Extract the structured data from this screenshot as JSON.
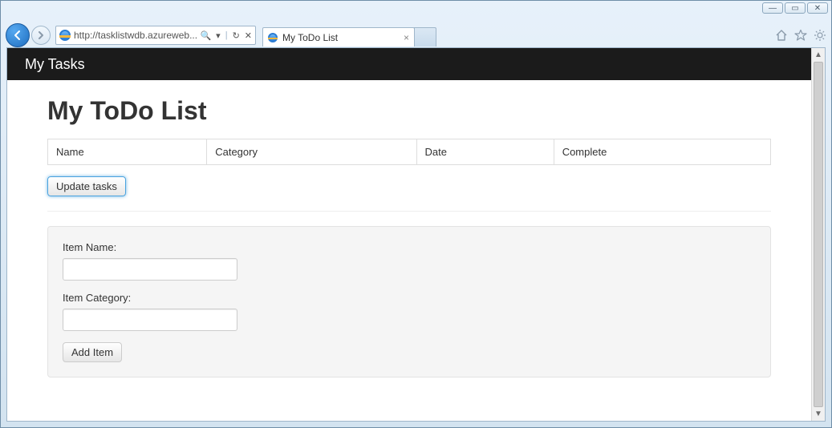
{
  "window": {
    "minimize_glyph": "—",
    "maximize_glyph": "▭",
    "close_glyph": "✕"
  },
  "browser": {
    "url_display": "http://tasklistwdb.azureweb...",
    "search_glyph": "🔍",
    "dropdown_glyph": "▾",
    "refresh_glyph": "↻",
    "stop_glyph": "✕",
    "tab_title": "My ToDo List",
    "tab_close_glyph": "×"
  },
  "navbar": {
    "brand": "My Tasks"
  },
  "page": {
    "heading": "My ToDo List",
    "table": {
      "headers": [
        "Name",
        "Category",
        "Date",
        "Complete"
      ]
    },
    "update_button": "Update tasks",
    "form": {
      "item_name_label": "Item Name:",
      "item_name_value": "",
      "item_category_label": "Item Category:",
      "item_category_value": "",
      "add_button": "Add Item"
    }
  }
}
